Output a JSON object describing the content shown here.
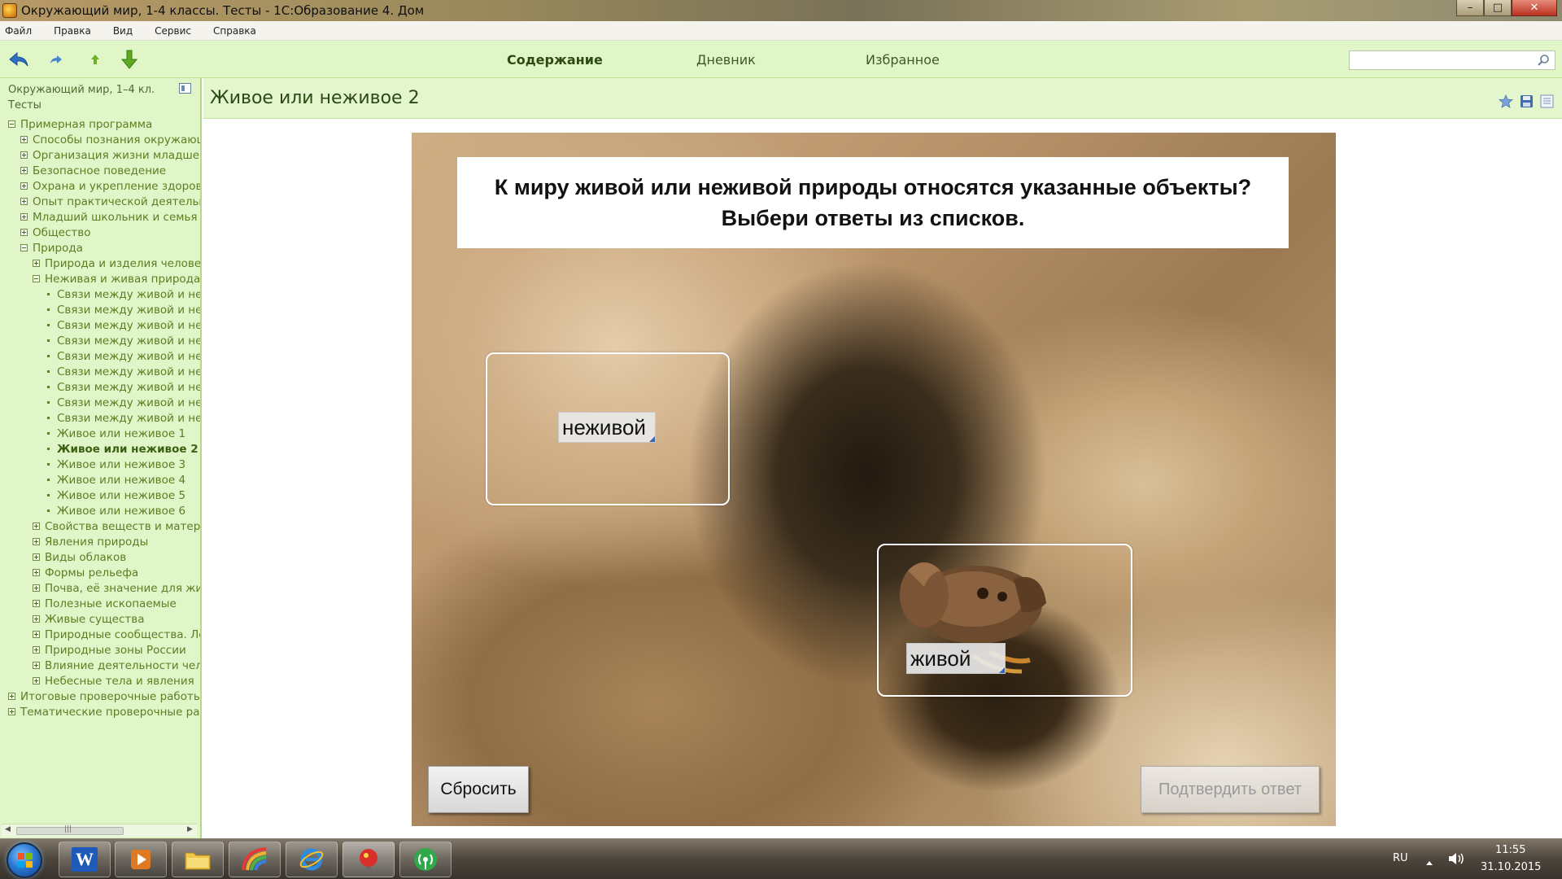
{
  "window": {
    "title": "Окружающий мир, 1-4 классы. Тесты - 1С:Образование 4. Дом",
    "minimize": "–",
    "maximize": "□",
    "close": "✕"
  },
  "menu": [
    "Файл",
    "Правка",
    "Вид",
    "Сервис",
    "Справка"
  ],
  "toolbar": {
    "tabs": [
      "Содержание",
      "Дневник",
      "Избранное"
    ],
    "active_tab": "Содержание",
    "search_value": ""
  },
  "sidebar": {
    "header": "Окружающий мир, 1–4 кл. Тесты",
    "tree": [
      {
        "label": "Примерная программа",
        "level": 0,
        "kind": "minus"
      },
      {
        "label": "Способы познания окружающего мира",
        "level": 1,
        "kind": "plus"
      },
      {
        "label": "Организация жизни младшего школьника",
        "level": 1,
        "kind": "plus"
      },
      {
        "label": "Безопасное поведение",
        "level": 1,
        "kind": "plus"
      },
      {
        "label": "Охрана и укрепление здоровья",
        "level": 1,
        "kind": "plus"
      },
      {
        "label": "Опыт практической деятельности",
        "level": 1,
        "kind": "plus"
      },
      {
        "label": "Младший школьник и семья",
        "level": 1,
        "kind": "plus"
      },
      {
        "label": "Общество",
        "level": 1,
        "kind": "plus"
      },
      {
        "label": "Природа",
        "level": 1,
        "kind": "minus"
      },
      {
        "label": "Природа и изделия человека",
        "level": 2,
        "kind": "plus"
      },
      {
        "label": "Неживая и живая природа",
        "level": 2,
        "kind": "minus"
      },
      {
        "label": "Связи между живой и неживой природой",
        "level": 3,
        "kind": "leaf"
      },
      {
        "label": "Связи между живой и неживой природой",
        "level": 3,
        "kind": "leaf"
      },
      {
        "label": "Связи между живой и неживой природой",
        "level": 3,
        "kind": "leaf"
      },
      {
        "label": "Связи между живой и неживой природой",
        "level": 3,
        "kind": "leaf"
      },
      {
        "label": "Связи между живой и неживой природой",
        "level": 3,
        "kind": "leaf"
      },
      {
        "label": "Связи между живой и неживой природой",
        "level": 3,
        "kind": "leaf"
      },
      {
        "label": "Связи между живой и неживой природой",
        "level": 3,
        "kind": "leaf"
      },
      {
        "label": "Связи между живой и неживой природой",
        "level": 3,
        "kind": "leaf"
      },
      {
        "label": "Связи между живой и неживой природой",
        "level": 3,
        "kind": "leaf"
      },
      {
        "label": "Живое или неживое 1",
        "level": 3,
        "kind": "leaf"
      },
      {
        "label": "Живое или неживое 2",
        "level": 3,
        "kind": "leaf",
        "selected": true
      },
      {
        "label": "Живое или неживое 3",
        "level": 3,
        "kind": "leaf"
      },
      {
        "label": "Живое или неживое 4",
        "level": 3,
        "kind": "leaf"
      },
      {
        "label": "Живое или неживое 5",
        "level": 3,
        "kind": "leaf"
      },
      {
        "label": "Живое или неживое 6",
        "level": 3,
        "kind": "leaf"
      },
      {
        "label": "Свойства веществ и материалов",
        "level": 2,
        "kind": "plus"
      },
      {
        "label": "Явления природы",
        "level": 2,
        "kind": "plus"
      },
      {
        "label": "Виды облаков",
        "level": 2,
        "kind": "plus"
      },
      {
        "label": "Формы рельефа",
        "level": 2,
        "kind": "plus"
      },
      {
        "label": "Почва, её значение для жизни",
        "level": 2,
        "kind": "plus"
      },
      {
        "label": "Полезные ископаемые",
        "level": 2,
        "kind": "plus"
      },
      {
        "label": "Живые существа",
        "level": 2,
        "kind": "plus"
      },
      {
        "label": "Природные сообщества. Лес",
        "level": 2,
        "kind": "plus"
      },
      {
        "label": "Природные зоны России",
        "level": 2,
        "kind": "plus"
      },
      {
        "label": "Влияние деятельности человека",
        "level": 2,
        "kind": "plus"
      },
      {
        "label": "Небесные тела и явления",
        "level": 2,
        "kind": "plus"
      },
      {
        "label": "Итоговые проверочные работы",
        "level": 0,
        "kind": "plus"
      },
      {
        "label": "Тематические проверочные работы",
        "level": 0,
        "kind": "plus"
      }
    ],
    "scroll_grip": "|||"
  },
  "content": {
    "title": "Живое или неживое 2",
    "question": "К миру живой или неживой природы относятся указанные объекты?\nВыбери ответы из списков.",
    "answers": {
      "rock": "неживой",
      "crab": "живой"
    },
    "reset_button": "Сбросить",
    "confirm_button": "Подтвердить ответ"
  },
  "taskbar": {
    "language": "RU",
    "time": "11:55",
    "date": "31.10.2015",
    "word_label": "W"
  },
  "colors": {
    "panel_green": "#e1f6c8",
    "tree_text": "#5b7e22",
    "title_green": "#2b4a14"
  }
}
